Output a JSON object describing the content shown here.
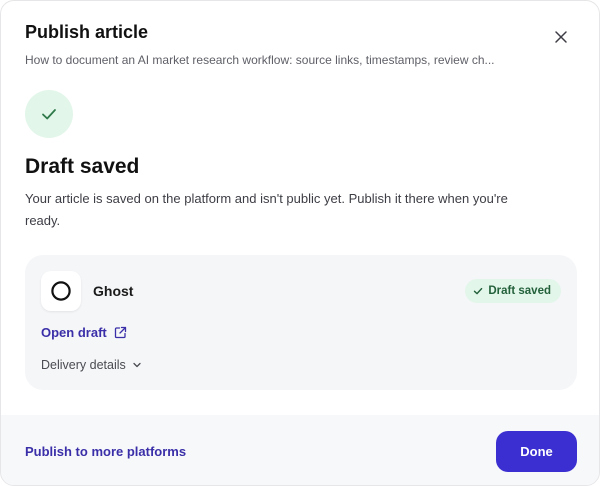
{
  "dialog": {
    "title": "Publish article",
    "subtitle": "How to document an AI market research workflow: source links, timestamps, review ch...",
    "close_icon": "close-icon"
  },
  "status": {
    "icon": "check-icon",
    "title": "Draft saved",
    "description": "Your article is saved on the platform and isn't public yet. Publish it there when you're ready."
  },
  "platform": {
    "name": "Ghost",
    "logo_icon": "ghost-logo-icon",
    "badge": "Draft saved",
    "open_draft_label": "Open draft",
    "delivery_label": "Delivery details"
  },
  "footer": {
    "more_platforms_label": "Publish to more platforms",
    "done_label": "Done"
  },
  "colors": {
    "accent": "#3b2fd1",
    "link": "#3a2fa8",
    "success_bg": "#e3f6ea",
    "success_text": "#23613b"
  }
}
